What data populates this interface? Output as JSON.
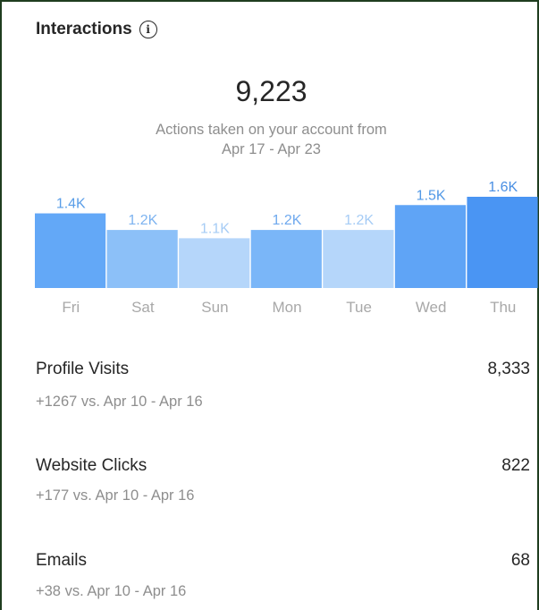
{
  "header": {
    "title": "Interactions",
    "info_icon": "info-icon"
  },
  "summary": {
    "total": "9,223",
    "subtitle_line1": "Actions taken on your account from",
    "subtitle_line2": "Apr 17 - Apr 23"
  },
  "chart_data": {
    "type": "bar",
    "categories": [
      "Fri",
      "Sat",
      "Sun",
      "Mon",
      "Tue",
      "Wed",
      "Thu"
    ],
    "values": [
      1.4,
      1.2,
      1.1,
      1.2,
      1.2,
      1.5,
      1.6
    ],
    "value_labels": [
      "1.4K",
      "1.2K",
      "1.1K",
      "1.2K",
      "1.2K",
      "1.5K",
      "1.6K"
    ],
    "bar_colors": [
      "#63a8f7",
      "#8cc0f8",
      "#b5d6fa",
      "#7ab6f8",
      "#b5d6fa",
      "#5fa4f6",
      "#4a95f3"
    ],
    "label_colors": [
      "#5a9ee8",
      "#7db3f0",
      "#a6ccf5",
      "#6fa9ee",
      "#a6ccf5",
      "#5198e6",
      "#4a8fe3"
    ],
    "tick_color": "#a8a8a8",
    "title": "",
    "xlabel": "",
    "ylabel": "",
    "ylim": [
      0,
      1.6
    ],
    "grid": false
  },
  "stats": [
    {
      "label": "Profile Visits",
      "value": "8,333",
      "delta": "+1267 vs. Apr 10 - Apr 16"
    },
    {
      "label": "Website Clicks",
      "value": "822",
      "delta": "+177 vs. Apr 10 - Apr 16"
    },
    {
      "label": "Emails",
      "value": "68",
      "delta": "+38 vs. Apr 10 - Apr 16"
    }
  ]
}
